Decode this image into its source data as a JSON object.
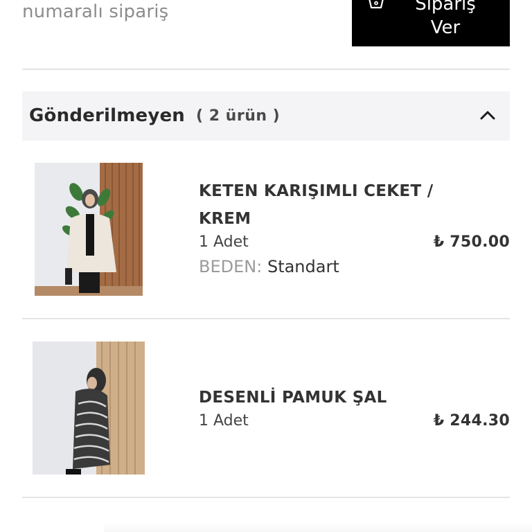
{
  "header": {
    "subtitle": "numaralı sipariş",
    "reorder_button_line1": "Sipariş",
    "reorder_button_line2": "Ver",
    "reorder_icon": "shopping-basket-icon"
  },
  "group": {
    "title": "Gönderilmeyen",
    "count": "( 2 ürün )",
    "toggle_icon": "chevron-up-icon"
  },
  "items": [
    {
      "name": "KETEN KARIŞIMLI CEKET / KREM",
      "quantity": "1 Adet",
      "price": "₺ 750.00",
      "size_label": "BEDEN:",
      "size_value": "Standart"
    },
    {
      "name": "DESENLİ PAMUK ŞAL",
      "quantity": "1 Adet",
      "price": "₺ 244.30"
    }
  ],
  "colors": {
    "button_bg": "#000000",
    "group_bg": "#f4f4f6",
    "divider": "#e4e4e4",
    "muted_text": "#8c8c8c"
  }
}
